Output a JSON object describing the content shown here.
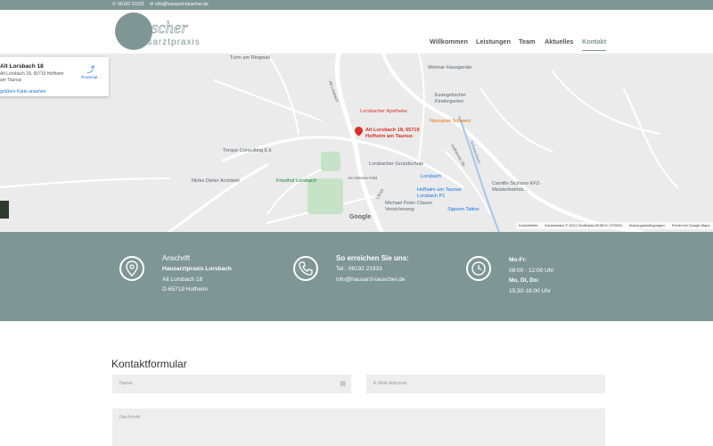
{
  "topbar": {
    "phone": "06192 21933",
    "email": "info@hausarzt-lauscher.de"
  },
  "logo": {
    "script": "Lauscher",
    "sub": "Hausarztpraxis"
  },
  "nav": [
    {
      "label": "Willkommen",
      "active": false
    },
    {
      "label": "Leistungen",
      "active": false
    },
    {
      "label": "Team",
      "active": false
    },
    {
      "label": "Aktuelles",
      "active": false
    },
    {
      "label": "Kontakt",
      "active": true
    }
  ],
  "map": {
    "card_title": "Alt Lorsbach 18",
    "card_address": "Alt Lorsbach 18, 65719 Hofheim am Taunus",
    "card_route": "Routenpl...",
    "card_link": "größere Karte ansehen",
    "pin_label": "Alt Lorsbach 18, 65719 Hofheim am Taunus",
    "places": [
      "Turm am Ringwall",
      "Weimar Hausgeräte",
      "Evangelischer Kindergarten",
      "Lorsbacher Apotheke",
      "Nassauer Schweiz",
      "Torque Consulting E.k",
      "Lorsbacher Grundschule",
      "Ninke Dieter Architekt",
      "Friedhof Lorsbach",
      "Lorsbach",
      "Camillo Siciliano KFZ-Meisterbetrieb...",
      "Hofheim am Taunus Lorsbach P1",
      "Michael Peter Clasen Versicherung",
      "Signum Tattoo"
    ],
    "streets": [
      "Alt Lorsbach",
      "Hofheimer Str.",
      "Schwarzbach",
      "L3016",
      "Am Kleinen Feld"
    ],
    "google": "Google",
    "footer": [
      "Kurzbefehle",
      "Kartendaten © 2021 GeoBasis-DE/BKG (©2009)",
      "Nutzungsbedingungen",
      "Fehler bei Google Maps"
    ]
  },
  "contact": {
    "address": {
      "heading": "Anschrift",
      "name": "Hausarztpraxis Lorsbach",
      "street": "Alt Lorsbach 18",
      "city": "D-65719 Hofheim"
    },
    "reach": {
      "heading": "So erreichen Sie uns:",
      "phone": "Tel.: 06192 21933",
      "email": "info@hausarzt-lauscher.de"
    },
    "hours": {
      "day1": "Mo-Fr:",
      "time1": "08:00 - 12:00 Uhr",
      "day2": "Mo, Di, Do:",
      "time2": "15:30-18:00 Uhr"
    }
  },
  "form": {
    "title": "Kontaktformular",
    "name_placeholder": "Name",
    "email_placeholder": "E-Mail-Adresse",
    "message_placeholder": "Nachricht"
  },
  "colors": {
    "accent": "#7f9696",
    "map_bg": "#ebebeb",
    "pin": "#d93025"
  }
}
